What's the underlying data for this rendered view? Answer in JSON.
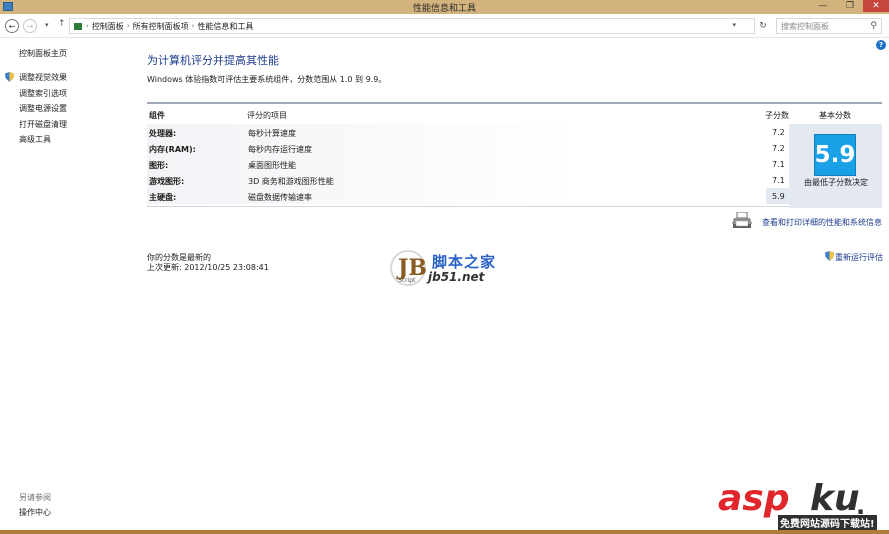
{
  "window": {
    "title": "性能信息和工具",
    "controls": {
      "minimize": "—",
      "maximize": "❐",
      "close": "✕"
    }
  },
  "addressbar": {
    "back": "←",
    "forward": "→",
    "recent": "▾",
    "up": "↑",
    "breadcrumbs": [
      "控制面板",
      "所有控制面板项",
      "性能信息和工具"
    ],
    "separator": "›",
    "dropdown": "▾",
    "refresh": "↻",
    "search_placeholder": "搜索控制面板",
    "search_glyph": "⚲"
  },
  "help": "?",
  "left_pane": {
    "home": "控制面板主页",
    "links": [
      "调整视觉效果",
      "调整索引选项",
      "调整电源设置",
      "打开磁盘清理",
      "高级工具"
    ],
    "see_also_title": "另请参阅",
    "see_also_links": [
      "操作中心"
    ]
  },
  "main": {
    "title": "为计算机评分并提高其性能",
    "description": "Windows 体验指数可评估主要系统组件，分数范围从 1.0 到 9.9。",
    "table": {
      "headers": {
        "component": "组件",
        "rated_item": "评分的项目",
        "subscore": "子分数",
        "base_score": "基本分数"
      },
      "rows": [
        {
          "component": "处理器:",
          "item": "每秒计算速度",
          "subscore": "7.2"
        },
        {
          "component": "内存(RAM):",
          "item": "每秒内存运行速度",
          "subscore": "7.2"
        },
        {
          "component": "图形:",
          "item": "桌面图形性能",
          "subscore": "7.1"
        },
        {
          "component": "游戏图形:",
          "item": "3D 商务和游戏图形性能",
          "subscore": "7.1"
        },
        {
          "component": "主硬盘:",
          "item": "磁盘数据传输速率",
          "subscore": "5.9"
        }
      ],
      "base_score": "5.9",
      "base_caption": "由最低子分数决定"
    },
    "detail_link": "查看和打印详细的性能和系统信息",
    "status": "你的分数是最新的",
    "last_updated": "上次更新: 2012/10/25 23:08:41",
    "rerun_link": "重新运行评估"
  },
  "watermarks": {
    "jb51_logo": "JB",
    "jb51_logo_sub": "Script",
    "jb51_cn": "脚本之家",
    "jb51_en": "jb51.net",
    "aspku_asp": "asp",
    "aspku_ku": "ku",
    "aspku_dot": ".",
    "aspku_sub": "免费网站源码下载站!"
  }
}
